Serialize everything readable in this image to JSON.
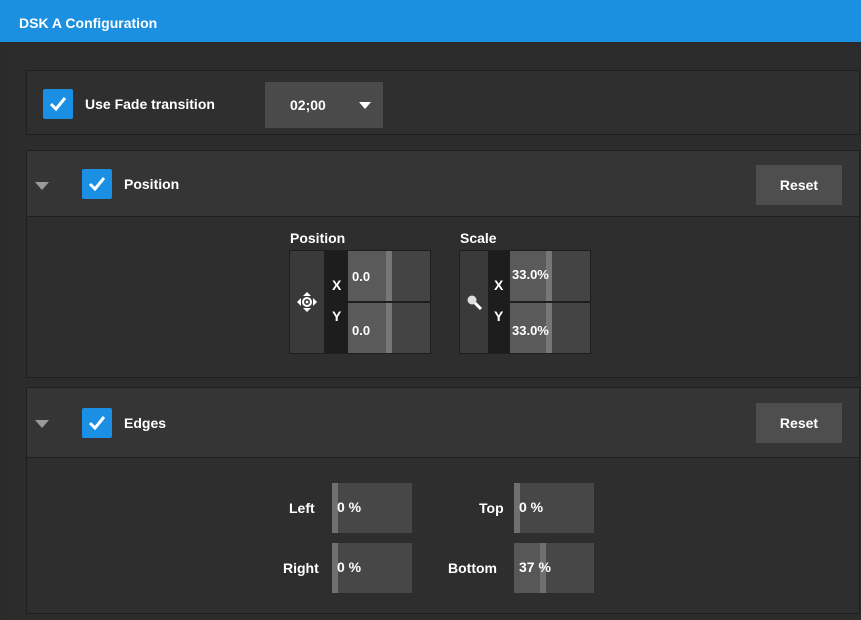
{
  "window": {
    "title": "DSK A Configuration"
  },
  "fade": {
    "checked": true,
    "label": "Use Fade transition",
    "duration": "02;00"
  },
  "position_section": {
    "label": "Position",
    "checked": true,
    "reset_label": "Reset",
    "position": {
      "label": "Position",
      "x_axis": "X",
      "y_axis": "Y",
      "x_value": "0.0",
      "y_value": "0.0"
    },
    "scale": {
      "label": "Scale",
      "x_axis": "X",
      "y_axis": "Y",
      "x_value": "33.0%",
      "y_value": "33.0%"
    }
  },
  "edges_section": {
    "label": "Edges",
    "checked": true,
    "reset_label": "Reset",
    "left": {
      "label": "Left",
      "value": "0 %"
    },
    "top": {
      "label": "Top",
      "value": "0 %"
    },
    "right": {
      "label": "Right",
      "value": "0 %"
    },
    "bottom": {
      "label": "Bottom",
      "value": "37 %"
    }
  },
  "colors": {
    "accent": "#1b8fe0",
    "checkbox": "#1a8fe3",
    "panel": "#2e2e2e",
    "field": "#474747"
  },
  "icons": {
    "move": "move-arrows-icon",
    "zoom": "magnifier-icon",
    "checkmark": "checkmark-icon",
    "collapse": "triangle-down-icon",
    "dropdown": "caret-down-icon"
  }
}
